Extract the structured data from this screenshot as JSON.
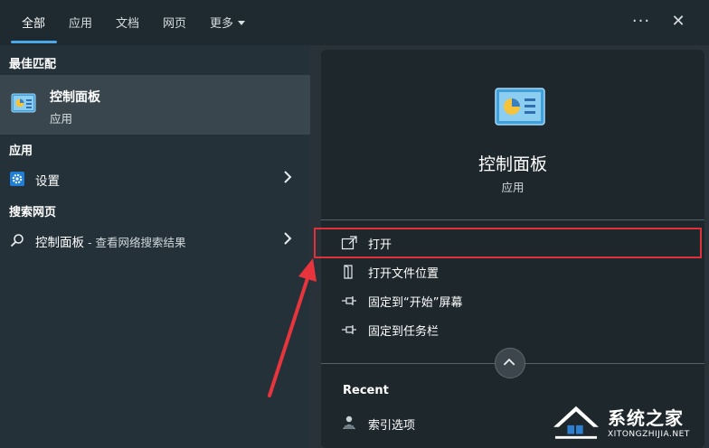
{
  "tabs": [
    {
      "label": "全部",
      "active": true
    },
    {
      "label": "应用"
    },
    {
      "label": "文档"
    },
    {
      "label": "网页"
    },
    {
      "label": "更多"
    }
  ],
  "window_buttons": {
    "more_icon": "ellipsis-icon",
    "close_icon": "close-icon",
    "more_glyph": "···",
    "close_glyph": "✕"
  },
  "left": {
    "best_match_header": "最佳匹配",
    "best_match": {
      "title": "控制面板",
      "subtitle": "应用",
      "icon": "control-panel-icon"
    },
    "apps_header": "应用",
    "apps": [
      {
        "label": "设置",
        "icon": "gear-icon"
      }
    ],
    "web_header": "搜索网页",
    "web": [
      {
        "label": "控制面板",
        "suffix": " - 查看网络搜索结果",
        "icon": "search-icon"
      }
    ]
  },
  "detail": {
    "title": "控制面板",
    "subtitle": "应用",
    "actions": [
      {
        "label": "打开",
        "icon": "open-icon"
      },
      {
        "label": "打开文件位置",
        "icon": "file-location-icon"
      },
      {
        "label": "固定到“开始”屏幕",
        "icon": "pin-icon"
      },
      {
        "label": "固定到任务栏",
        "icon": "pin-icon"
      }
    ],
    "recent_header": "Recent",
    "recent": [
      {
        "label": "索引选项",
        "icon": "indexing-options-icon"
      }
    ]
  },
  "watermark": {
    "text": "系统之家",
    "url": "XITONGZHIJIA.NET"
  },
  "colors": {
    "accent": "#4aa8e8",
    "highlight": "#e0303a",
    "arrow": "#e8343c"
  }
}
